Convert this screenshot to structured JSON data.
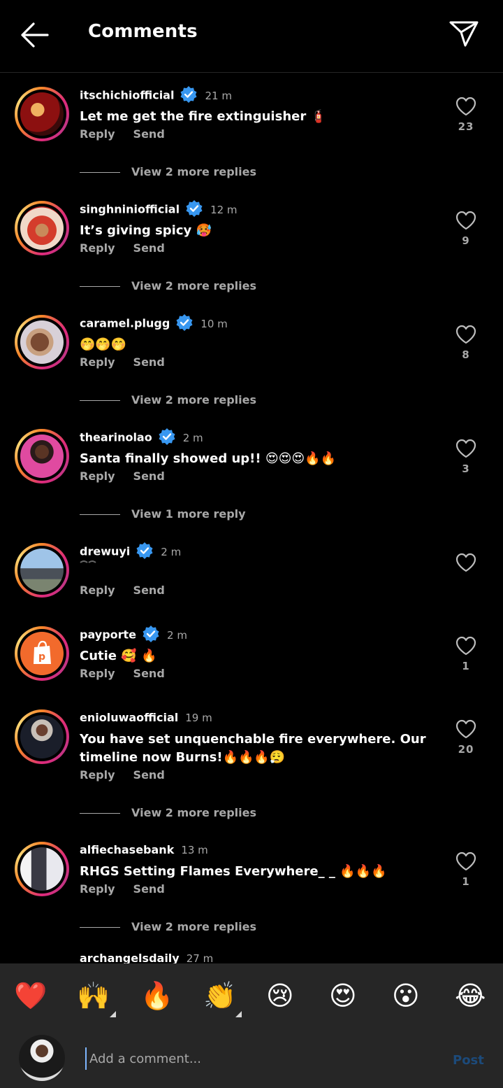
{
  "header": {
    "title": "Comments"
  },
  "icons": {
    "back": "arrow-left-icon",
    "send": "paper-plane-icon",
    "heart": "heart-outline-icon",
    "verified": "verified-badge-icon"
  },
  "comments": [
    {
      "username": "itschichiofficial",
      "verified": true,
      "time": "21 m",
      "text": "Let me get the fire extinguisher 🧯",
      "likes": "23",
      "reply": "Reply",
      "send": "Send",
      "view_replies": "View 2 more replies"
    },
    {
      "username": "singhniniofficial",
      "verified": true,
      "time": "12 m",
      "text": "It’s giving spicy 🥵",
      "likes": "9",
      "reply": "Reply",
      "send": "Send",
      "view_replies": "View 2 more replies"
    },
    {
      "username": "caramel.plugg",
      "verified": true,
      "time": "10 m",
      "text": "🤭🤭🤭",
      "likes": "8",
      "reply": "Reply",
      "send": "Send",
      "view_replies": "View 2 more replies"
    },
    {
      "username": "thearinolao",
      "verified": true,
      "time": "2 m",
      "text": "Santa finally showed up!! 😍😍😍🔥🔥",
      "likes": "3",
      "reply": "Reply",
      "send": "Send",
      "view_replies": "View 1 more reply"
    },
    {
      "username": "drewuyi",
      "verified": true,
      "time": "2 m",
      "text": "",
      "likes": "",
      "reply": "Reply",
      "send": "Send",
      "view_replies": ""
    },
    {
      "username": "payporte",
      "verified": true,
      "time": "2 m",
      "text": "Cutie 🥰 🔥",
      "likes": "1",
      "reply": "Reply",
      "send": "Send",
      "view_replies": ""
    },
    {
      "username": "enioluwaofficial",
      "verified": false,
      "time": "19 m",
      "text": "You have set unquenchable fire everywhere. Our timeline now Burns!🔥🔥🔥😮‍💨",
      "likes": "20",
      "reply": "Reply",
      "send": "Send",
      "view_replies": "View 2 more replies"
    },
    {
      "username": "alfiechasebank",
      "verified": false,
      "time": "13 m",
      "text": "RHGS Setting Flames Everywhere_ _ 🔥🔥🔥",
      "likes": "1",
      "reply": "Reply",
      "send": "Send",
      "view_replies": "View 2 more replies"
    }
  ],
  "partial_comment": {
    "username": "archangelsdaily",
    "time": "27 m"
  },
  "emoji_bar": [
    "❤️",
    "🙌",
    "🔥",
    "👏",
    "😢",
    "😍",
    "😮",
    "😂"
  ],
  "compose": {
    "placeholder": "Add a comment...",
    "post": "Post"
  }
}
